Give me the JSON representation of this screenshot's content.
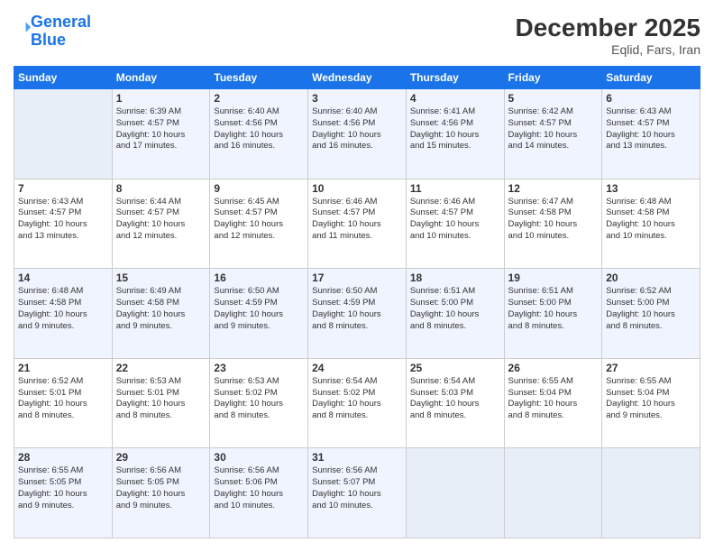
{
  "logo": {
    "line1": "General",
    "line2": "Blue"
  },
  "title": "December 2025",
  "subtitle": "Eqlid, Fars, Iran",
  "days_of_week": [
    "Sunday",
    "Monday",
    "Tuesday",
    "Wednesday",
    "Thursday",
    "Friday",
    "Saturday"
  ],
  "weeks": [
    [
      {
        "day": "",
        "sunrise": "",
        "sunset": "",
        "daylight": ""
      },
      {
        "day": "1",
        "sunrise": "Sunrise: 6:39 AM",
        "sunset": "Sunset: 4:57 PM",
        "daylight": "Daylight: 10 hours and 17 minutes."
      },
      {
        "day": "2",
        "sunrise": "Sunrise: 6:40 AM",
        "sunset": "Sunset: 4:56 PM",
        "daylight": "Daylight: 10 hours and 16 minutes."
      },
      {
        "day": "3",
        "sunrise": "Sunrise: 6:40 AM",
        "sunset": "Sunset: 4:56 PM",
        "daylight": "Daylight: 10 hours and 16 minutes."
      },
      {
        "day": "4",
        "sunrise": "Sunrise: 6:41 AM",
        "sunset": "Sunset: 4:56 PM",
        "daylight": "Daylight: 10 hours and 15 minutes."
      },
      {
        "day": "5",
        "sunrise": "Sunrise: 6:42 AM",
        "sunset": "Sunset: 4:57 PM",
        "daylight": "Daylight: 10 hours and 14 minutes."
      },
      {
        "day": "6",
        "sunrise": "Sunrise: 6:43 AM",
        "sunset": "Sunset: 4:57 PM",
        "daylight": "Daylight: 10 hours and 13 minutes."
      }
    ],
    [
      {
        "day": "7",
        "sunrise": "Sunrise: 6:43 AM",
        "sunset": "Sunset: 4:57 PM",
        "daylight": "Daylight: 10 hours and 13 minutes."
      },
      {
        "day": "8",
        "sunrise": "Sunrise: 6:44 AM",
        "sunset": "Sunset: 4:57 PM",
        "daylight": "Daylight: 10 hours and 12 minutes."
      },
      {
        "day": "9",
        "sunrise": "Sunrise: 6:45 AM",
        "sunset": "Sunset: 4:57 PM",
        "daylight": "Daylight: 10 hours and 12 minutes."
      },
      {
        "day": "10",
        "sunrise": "Sunrise: 6:46 AM",
        "sunset": "Sunset: 4:57 PM",
        "daylight": "Daylight: 10 hours and 11 minutes."
      },
      {
        "day": "11",
        "sunrise": "Sunrise: 6:46 AM",
        "sunset": "Sunset: 4:57 PM",
        "daylight": "Daylight: 10 hours and 10 minutes."
      },
      {
        "day": "12",
        "sunrise": "Sunrise: 6:47 AM",
        "sunset": "Sunset: 4:58 PM",
        "daylight": "Daylight: 10 hours and 10 minutes."
      },
      {
        "day": "13",
        "sunrise": "Sunrise: 6:48 AM",
        "sunset": "Sunset: 4:58 PM",
        "daylight": "Daylight: 10 hours and 10 minutes."
      }
    ],
    [
      {
        "day": "14",
        "sunrise": "Sunrise: 6:48 AM",
        "sunset": "Sunset: 4:58 PM",
        "daylight": "Daylight: 10 hours and 9 minutes."
      },
      {
        "day": "15",
        "sunrise": "Sunrise: 6:49 AM",
        "sunset": "Sunset: 4:58 PM",
        "daylight": "Daylight: 10 hours and 9 minutes."
      },
      {
        "day": "16",
        "sunrise": "Sunrise: 6:50 AM",
        "sunset": "Sunset: 4:59 PM",
        "daylight": "Daylight: 10 hours and 9 minutes."
      },
      {
        "day": "17",
        "sunrise": "Sunrise: 6:50 AM",
        "sunset": "Sunset: 4:59 PM",
        "daylight": "Daylight: 10 hours and 8 minutes."
      },
      {
        "day": "18",
        "sunrise": "Sunrise: 6:51 AM",
        "sunset": "Sunset: 5:00 PM",
        "daylight": "Daylight: 10 hours and 8 minutes."
      },
      {
        "day": "19",
        "sunrise": "Sunrise: 6:51 AM",
        "sunset": "Sunset: 5:00 PM",
        "daylight": "Daylight: 10 hours and 8 minutes."
      },
      {
        "day": "20",
        "sunrise": "Sunrise: 6:52 AM",
        "sunset": "Sunset: 5:00 PM",
        "daylight": "Daylight: 10 hours and 8 minutes."
      }
    ],
    [
      {
        "day": "21",
        "sunrise": "Sunrise: 6:52 AM",
        "sunset": "Sunset: 5:01 PM",
        "daylight": "Daylight: 10 hours and 8 minutes."
      },
      {
        "day": "22",
        "sunrise": "Sunrise: 6:53 AM",
        "sunset": "Sunset: 5:01 PM",
        "daylight": "Daylight: 10 hours and 8 minutes."
      },
      {
        "day": "23",
        "sunrise": "Sunrise: 6:53 AM",
        "sunset": "Sunset: 5:02 PM",
        "daylight": "Daylight: 10 hours and 8 minutes."
      },
      {
        "day": "24",
        "sunrise": "Sunrise: 6:54 AM",
        "sunset": "Sunset: 5:02 PM",
        "daylight": "Daylight: 10 hours and 8 minutes."
      },
      {
        "day": "25",
        "sunrise": "Sunrise: 6:54 AM",
        "sunset": "Sunset: 5:03 PM",
        "daylight": "Daylight: 10 hours and 8 minutes."
      },
      {
        "day": "26",
        "sunrise": "Sunrise: 6:55 AM",
        "sunset": "Sunset: 5:04 PM",
        "daylight": "Daylight: 10 hours and 8 minutes."
      },
      {
        "day": "27",
        "sunrise": "Sunrise: 6:55 AM",
        "sunset": "Sunset: 5:04 PM",
        "daylight": "Daylight: 10 hours and 9 minutes."
      }
    ],
    [
      {
        "day": "28",
        "sunrise": "Sunrise: 6:55 AM",
        "sunset": "Sunset: 5:05 PM",
        "daylight": "Daylight: 10 hours and 9 minutes."
      },
      {
        "day": "29",
        "sunrise": "Sunrise: 6:56 AM",
        "sunset": "Sunset: 5:05 PM",
        "daylight": "Daylight: 10 hours and 9 minutes."
      },
      {
        "day": "30",
        "sunrise": "Sunrise: 6:56 AM",
        "sunset": "Sunset: 5:06 PM",
        "daylight": "Daylight: 10 hours and 10 minutes."
      },
      {
        "day": "31",
        "sunrise": "Sunrise: 6:56 AM",
        "sunset": "Sunset: 5:07 PM",
        "daylight": "Daylight: 10 hours and 10 minutes."
      },
      {
        "day": "",
        "sunrise": "",
        "sunset": "",
        "daylight": ""
      },
      {
        "day": "",
        "sunrise": "",
        "sunset": "",
        "daylight": ""
      },
      {
        "day": "",
        "sunrise": "",
        "sunset": "",
        "daylight": ""
      }
    ]
  ]
}
